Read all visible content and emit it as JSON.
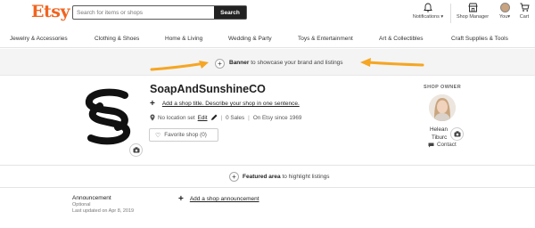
{
  "header": {
    "logo": "Etsy",
    "search_placeholder": "Search for items or shops",
    "search_button": "Search",
    "notifications_label": "Notifications",
    "shop_manager_label": "Shop Manager",
    "you_label": "You",
    "cart_label": "Cart"
  },
  "categories": [
    "Jewelry & Accessories",
    "Clothing & Shoes",
    "Home & Living",
    "Wedding & Party",
    "Toys & Entertainment",
    "Art & Collectibles",
    "Craft Supplies & Tools"
  ],
  "banner": {
    "bold": "Banner",
    "text": " to showcase your brand and listings",
    "arrow_color": "#f5a623"
  },
  "shop": {
    "name": "SoapAndSunshineCO",
    "add_title": "Add a shop title. Describe your shop in one sentence.",
    "location": "No location set",
    "edit": "Edit",
    "sales": "0 Sales",
    "since": "On Etsy since 1969",
    "favorite": "Favorite shop (0)"
  },
  "owner": {
    "label": "SHOP OWNER",
    "first": "Helean",
    "last": "Tiburc",
    "contact": "Contact"
  },
  "featured": {
    "bold": "Featured area",
    "text": " to highlight listings"
  },
  "announcement": {
    "title": "Announcement",
    "optional": "Optional",
    "updated": "Last updated on Apr 8, 2019",
    "add_link": "Add a shop announcement"
  },
  "colors": {
    "brand": "#f1641e",
    "arrow": "#f5a623"
  }
}
